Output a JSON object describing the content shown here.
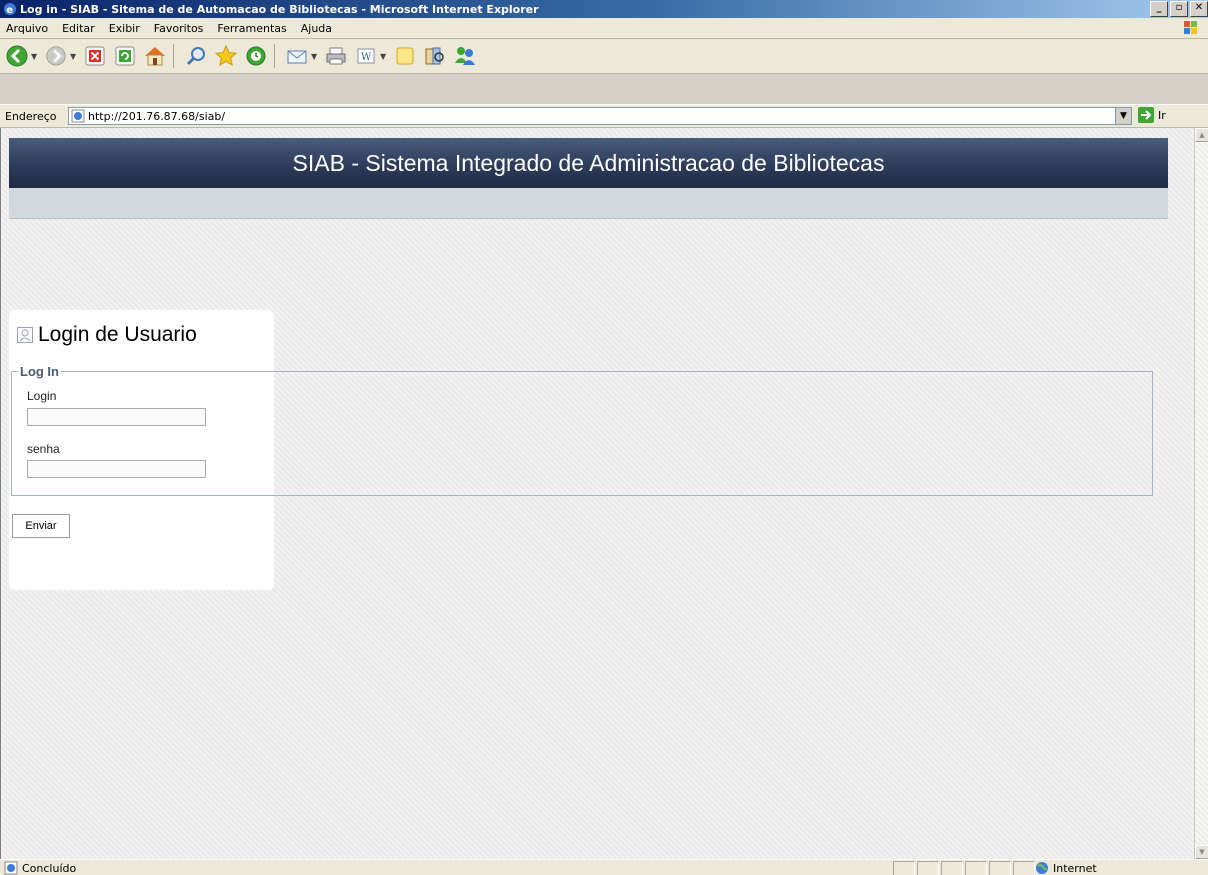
{
  "window": {
    "title": "Log in - SIAB - Sitema de de Automacao de Bibliotecas - Microsoft Internet Explorer",
    "controls": {
      "minimize": "_",
      "maximize": "▫",
      "close": "✕"
    }
  },
  "menubar": {
    "items": [
      "Arquivo",
      "Editar",
      "Exibir",
      "Favoritos",
      "Ferramentas",
      "Ajuda"
    ]
  },
  "toolbar": {
    "icons": [
      "back-icon",
      "forward-icon",
      "stop-icon",
      "refresh-icon",
      "home-icon",
      "search-icon",
      "favorites-icon",
      "history-icon",
      "mail-icon",
      "print-icon",
      "edit-icon",
      "discuss-icon",
      "research-icon",
      "messenger-icon"
    ]
  },
  "address": {
    "label": "Endereço",
    "url": "http://201.76.87.68/siab/",
    "go_label": "Ir"
  },
  "page": {
    "header": "SIAB - Sistema Integrado de Administracao de Bibliotecas",
    "login": {
      "title": "Login de Usuario",
      "legend": "Log In",
      "login_label": "Login",
      "login_value": "",
      "password_label": "senha",
      "password_value": "",
      "submit_label": "Enviar"
    }
  },
  "status": {
    "text": "Concluído",
    "zone": "Internet"
  },
  "colors": {
    "header_bg": "#2c3a58",
    "titlebar": "#0a246a",
    "legend_text": "#4b5a76"
  }
}
